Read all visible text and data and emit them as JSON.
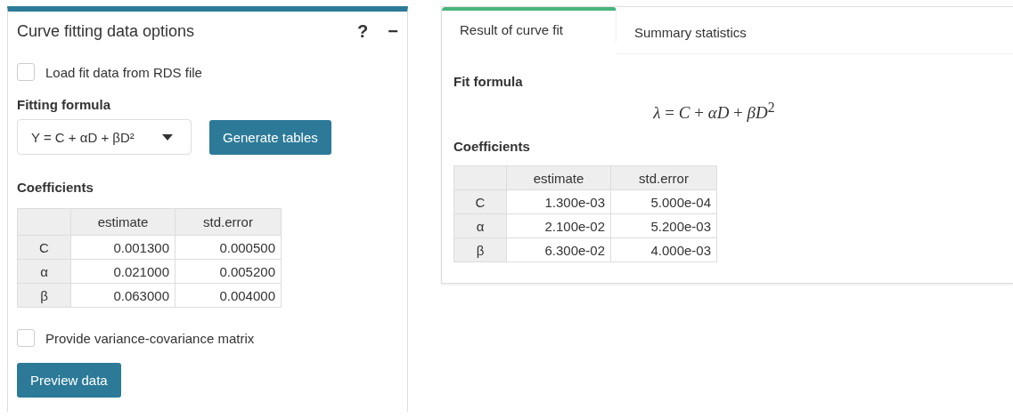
{
  "left_panel": {
    "title": "Curve fitting data options",
    "help": "?",
    "collapse": "−",
    "load_checkbox": {
      "label": "Load fit data from RDS file",
      "checked": false
    },
    "formula_label": "Fitting formula",
    "formula_select": {
      "value": "Y = C + αD + βD²"
    },
    "generate_button": "Generate tables",
    "coefficients_label": "Coefficients",
    "table": {
      "columns": [
        "",
        "estimate",
        "std.error"
      ],
      "rows": [
        [
          "C",
          "0.001300",
          "0.000500"
        ],
        [
          "α",
          "0.021000",
          "0.005200"
        ],
        [
          "β",
          "0.063000",
          "0.004000"
        ]
      ]
    },
    "covariance_checkbox": {
      "label": "Provide variance-covariance matrix",
      "checked": false
    },
    "preview_button": "Preview data"
  },
  "right_panel": {
    "tabs": [
      {
        "label": "Result of curve fit",
        "selected": true
      },
      {
        "label": "Summary statistics",
        "selected": false
      }
    ],
    "fit_formula_label": "Fit formula",
    "formula": "*λ* = *C* + *αD* + *βD*$^{2}$",
    "coefficients_label": "Coefficients",
    "table": {
      "columns": [
        "",
        "estimate",
        "std.error"
      ],
      "rows": [
        [
          "C",
          "1.300e-03",
          "5.000e-04"
        ],
        [
          "α",
          "2.100e-02",
          "5.200e-03"
        ],
        [
          "β",
          "6.300e-02",
          "4.000e-03"
        ]
      ]
    }
  }
}
